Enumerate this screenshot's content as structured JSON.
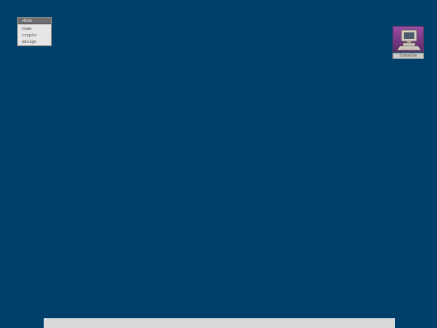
{
  "menu_window": {
    "title": "nDum",
    "items": [
      {
        "label": "home"
      },
      {
        "label": "crypto"
      },
      {
        "label": "design"
      }
    ]
  },
  "desktop_icon": {
    "icon": "computer-icon",
    "label": "Console"
  },
  "colors": {
    "desktop_background": "#003f69",
    "menu_background": "#e6e6e6",
    "menu_title_background": "#6f6f6f",
    "icon_background": "#8a4496",
    "taskbar_background": "#d9d9d9"
  }
}
